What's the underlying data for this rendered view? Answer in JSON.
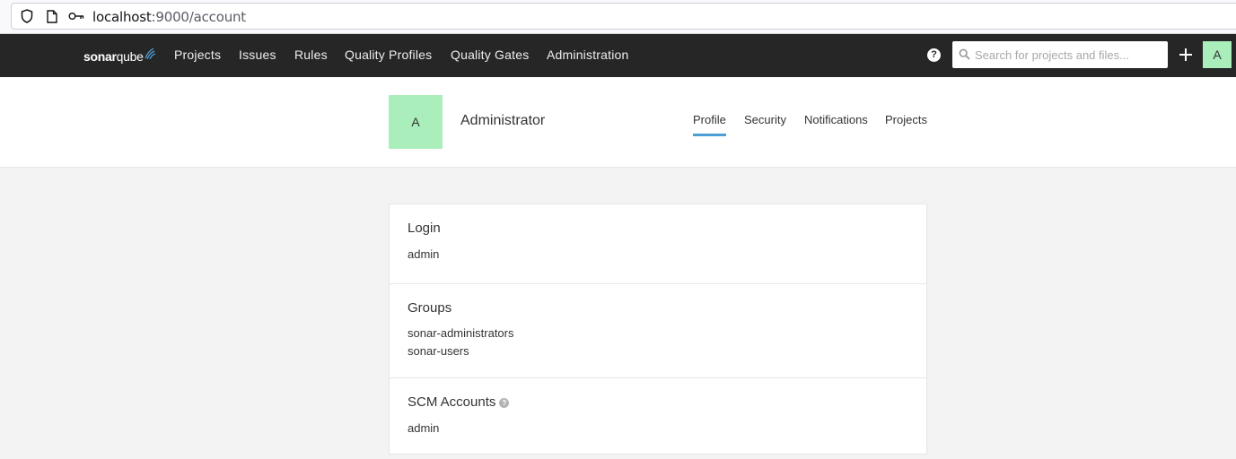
{
  "browser": {
    "url_host": "localhost",
    "url_path": ":9000/account"
  },
  "navbar": {
    "logo_bold": "sonar",
    "logo_light": "qube",
    "items": [
      {
        "label": "Projects"
      },
      {
        "label": "Issues"
      },
      {
        "label": "Rules"
      },
      {
        "label": "Quality Profiles"
      },
      {
        "label": "Quality Gates"
      },
      {
        "label": "Administration"
      }
    ],
    "help_label": "?",
    "search_placeholder": "Search for projects and files...",
    "avatar_letter": "A"
  },
  "account": {
    "avatar_letter": "A",
    "name": "Administrator",
    "tabs": [
      {
        "label": "Profile",
        "active": true
      },
      {
        "label": "Security"
      },
      {
        "label": "Notifications"
      },
      {
        "label": "Projects"
      }
    ]
  },
  "profile": {
    "login_title": "Login",
    "login_value": "admin",
    "groups_title": "Groups",
    "groups": [
      "sonar-administrators",
      "sonar-users"
    ],
    "scm_title": "SCM Accounts",
    "scm_help": "?",
    "scm_accounts": [
      "admin"
    ]
  },
  "colors": {
    "navbar_bg": "#262626",
    "avatar_bg": "#aaeebb",
    "active_tab_underline": "#4b9fd5",
    "page_bg": "#f3f3f3"
  }
}
